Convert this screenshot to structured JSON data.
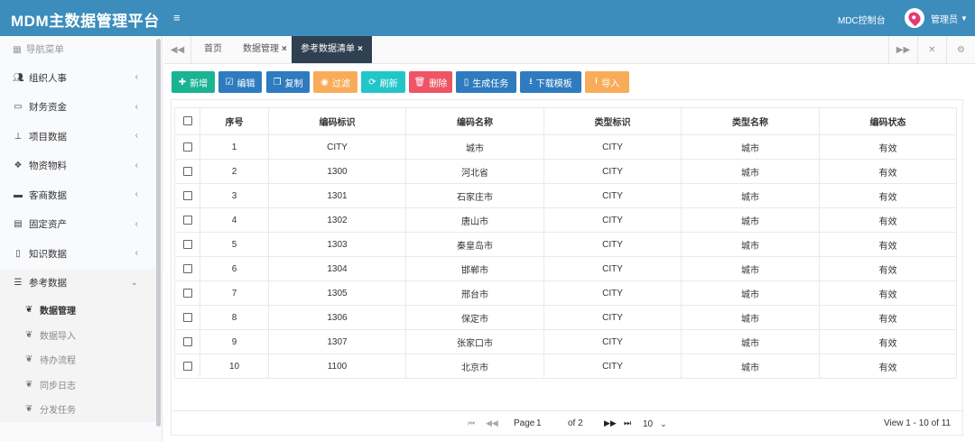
{
  "app": {
    "title": "MDM主数据管理平台",
    "menu_toggle": "≡"
  },
  "topnav": {
    "console_link": "MDC控制台",
    "username": "管理员"
  },
  "sidebar": {
    "header": "导航菜单",
    "items": [
      {
        "label": "组织人事",
        "icon": "users-icon"
      },
      {
        "label": "财务资金",
        "icon": "card-icon"
      },
      {
        "label": "项目数据",
        "icon": "sitemap-icon"
      },
      {
        "label": "物资物料",
        "icon": "cubes-icon"
      },
      {
        "label": "客商数据",
        "icon": "briefcase-icon"
      },
      {
        "label": "固定资产",
        "icon": "building-icon"
      },
      {
        "label": "知识数据",
        "icon": "file-icon"
      },
      {
        "label": "参考数据",
        "icon": "list-icon"
      }
    ],
    "subitems": [
      "数据管理",
      "数据导入",
      "待办流程",
      "同步日志",
      "分发任务"
    ],
    "active_subitem": "数据管理"
  },
  "tabs": [
    {
      "label": "首页",
      "closable": false
    },
    {
      "label": "数据管理",
      "closable": true
    },
    {
      "label": "参考数据清单",
      "closable": true,
      "active": true
    }
  ],
  "toolbar": {
    "add": "新增",
    "edit": "编辑",
    "copy": "复制",
    "filter": "过滤",
    "refresh": "刷新",
    "delete": "删除",
    "generate_task": "生成任务",
    "download_template": "下载模板",
    "import": "导入"
  },
  "table": {
    "headers": [
      "序号",
      "编码标识",
      "编码名称",
      "类型标识",
      "类型名称",
      "编码状态"
    ],
    "rows": [
      [
        "1",
        "CITY",
        "城市",
        "CITY",
        "城市",
        "有效"
      ],
      [
        "2",
        "1300",
        "河北省",
        "CITY",
        "城市",
        "有效"
      ],
      [
        "3",
        "1301",
        "石家庄市",
        "CITY",
        "城市",
        "有效"
      ],
      [
        "4",
        "1302",
        "唐山市",
        "CITY",
        "城市",
        "有效"
      ],
      [
        "5",
        "1303",
        "秦皇岛市",
        "CITY",
        "城市",
        "有效"
      ],
      [
        "6",
        "1304",
        "邯郸市",
        "CITY",
        "城市",
        "有效"
      ],
      [
        "7",
        "1305",
        "邢台市",
        "CITY",
        "城市",
        "有效"
      ],
      [
        "8",
        "1306",
        "保定市",
        "CITY",
        "城市",
        "有效"
      ],
      [
        "9",
        "1307",
        "张家口市",
        "CITY",
        "城市",
        "有效"
      ],
      [
        "10",
        "1100",
        "北京市",
        "CITY",
        "城市",
        "有效"
      ]
    ]
  },
  "pager": {
    "page_label": "Page",
    "page_value": "1",
    "of_label": "of 2",
    "page_size": "10",
    "view_text": "View 1 - 10 of 11"
  },
  "colors": {
    "header_bg": "#3c8dbc",
    "active_tab": "#2f4050",
    "green": "#1ab394",
    "blue": "#2f7bbf",
    "orange": "#f8ac59",
    "cyan": "#23c6c8",
    "red": "#ed5565"
  }
}
